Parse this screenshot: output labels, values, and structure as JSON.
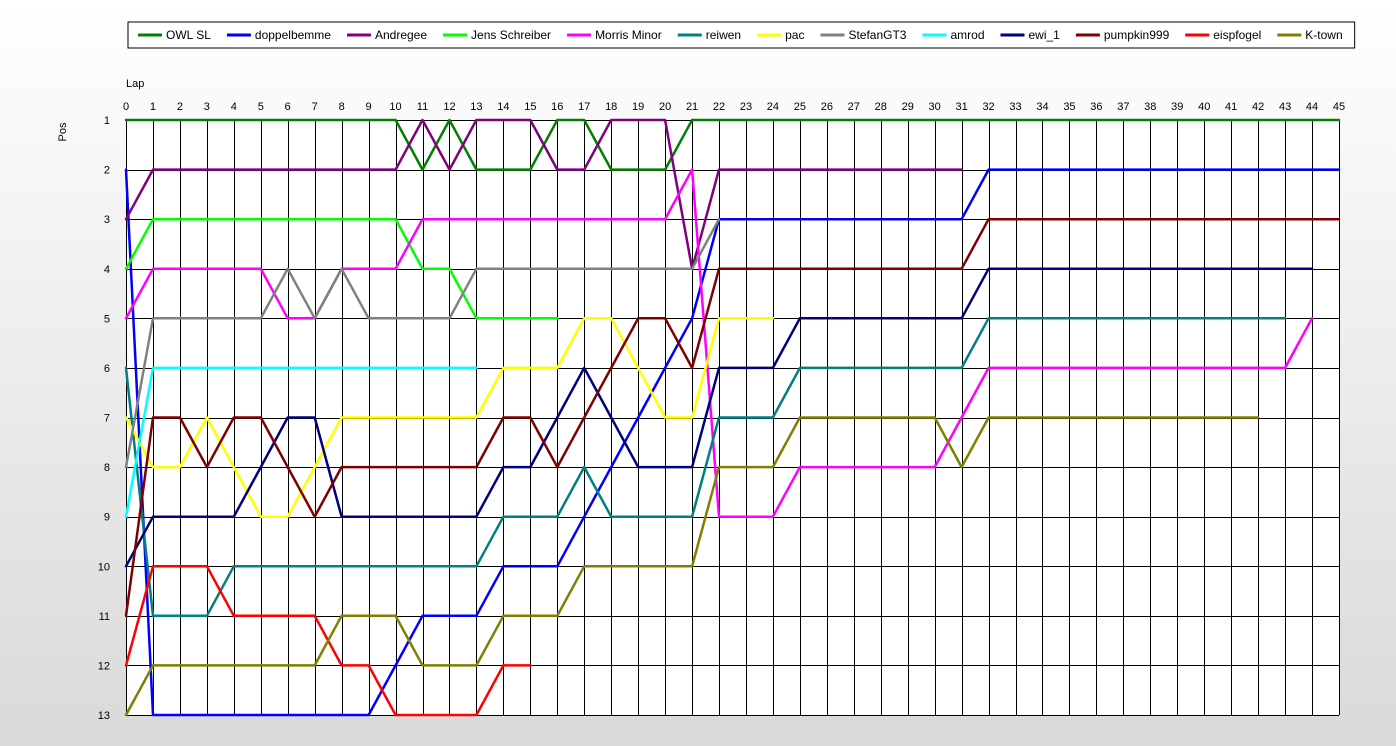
{
  "chart_data": {
    "type": "line",
    "xlabel": "Lap",
    "ylabel": "Pos",
    "xlim": [
      0,
      45
    ],
    "ylim": [
      1,
      13
    ],
    "y_inverted": true,
    "grid": true,
    "legend_position": "top",
    "x_ticks": [
      0,
      1,
      2,
      3,
      4,
      5,
      6,
      7,
      8,
      9,
      10,
      11,
      12,
      13,
      14,
      15,
      16,
      17,
      18,
      19,
      20,
      21,
      22,
      23,
      24,
      25,
      26,
      27,
      28,
      29,
      30,
      31,
      32,
      33,
      34,
      35,
      36,
      37,
      38,
      39,
      40,
      41,
      42,
      43,
      44,
      45
    ],
    "y_ticks": [
      1,
      2,
      3,
      4,
      5,
      6,
      7,
      8,
      9,
      10,
      11,
      12,
      13
    ],
    "series": [
      {
        "name": "OWL SL",
        "color": "#008000",
        "start_lap": 0,
        "positions": [
          1,
          1,
          1,
          1,
          1,
          1,
          1,
          1,
          1,
          1,
          1,
          2,
          1,
          2,
          2,
          2,
          1,
          1,
          2,
          2,
          2,
          1,
          1,
          1,
          1,
          1,
          1,
          1,
          1,
          1,
          1,
          1,
          1,
          1,
          1,
          1,
          1,
          1,
          1,
          1,
          1,
          1,
          1,
          1,
          1,
          1
        ]
      },
      {
        "name": "doppelbemme",
        "color": "#0000ff",
        "start_lap": 0,
        "positions": [
          2,
          13,
          13,
          13,
          13,
          13,
          13,
          13,
          13,
          13,
          12,
          11,
          11,
          11,
          10,
          10,
          10,
          9,
          8,
          7,
          6,
          5,
          3,
          3,
          3,
          3,
          3,
          3,
          3,
          3,
          3,
          3,
          2,
          2,
          2,
          2,
          2,
          2,
          2,
          2,
          2,
          2,
          2,
          2,
          2,
          2
        ]
      },
      {
        "name": "Andregee",
        "color": "#800080",
        "start_lap": 0,
        "positions": [
          3,
          2,
          2,
          2,
          2,
          2,
          2,
          2,
          2,
          2,
          2,
          1,
          2,
          1,
          1,
          1,
          2,
          2,
          1,
          1,
          1,
          4,
          2,
          2,
          2,
          2,
          2,
          2,
          2,
          2,
          2,
          2
        ]
      },
      {
        "name": "Jens Schreiber",
        "color": "#00ff00",
        "start_lap": 0,
        "positions": [
          4,
          3,
          3,
          3,
          3,
          3,
          3,
          3,
          3,
          3,
          3,
          4,
          4,
          5,
          5,
          5,
          5
        ]
      },
      {
        "name": "Morris Minor",
        "color": "#ff00ff",
        "start_lap": 0,
        "positions": [
          5,
          4,
          4,
          4,
          4,
          4,
          5,
          5,
          4,
          4,
          4,
          3,
          3,
          3,
          3,
          3,
          3,
          3,
          3,
          3,
          3,
          2,
          9,
          9,
          9,
          8,
          8,
          8,
          8,
          8,
          8,
          7,
          6,
          6,
          6,
          6,
          6,
          6,
          6,
          6,
          6,
          6,
          6,
          6,
          5
        ]
      },
      {
        "name": "reiwen",
        "color": "#008080",
        "start_lap": 0,
        "positions": [
          6,
          11,
          11,
          11,
          10,
          10,
          10,
          10,
          10,
          10,
          10,
          10,
          10,
          10,
          9,
          9,
          9,
          8,
          9,
          9,
          9,
          9,
          7,
          7,
          7,
          6,
          6,
          6,
          6,
          6,
          6,
          6,
          5,
          5,
          5,
          5,
          5,
          5,
          5,
          5,
          5,
          5,
          5,
          5
        ]
      },
      {
        "name": "pac",
        "color": "#ffff00",
        "start_lap": 0,
        "positions": [
          7,
          8,
          8,
          7,
          8,
          9,
          9,
          8,
          7,
          7,
          7,
          7,
          7,
          7,
          6,
          6,
          6,
          5,
          5,
          6,
          7,
          7,
          5,
          5,
          5
        ]
      },
      {
        "name": "StefanGT3",
        "color": "#808080",
        "start_lap": 0,
        "positions": [
          8,
          5,
          5,
          5,
          5,
          5,
          4,
          5,
          4,
          5,
          5,
          5,
          5,
          4,
          4,
          4,
          4,
          4,
          4,
          4,
          4,
          4,
          3
        ]
      },
      {
        "name": "amrod",
        "color": "#00ffff",
        "start_lap": 0,
        "positions": [
          9,
          6,
          6,
          6,
          6,
          6,
          6,
          6,
          6,
          6,
          6,
          6,
          6,
          6
        ]
      },
      {
        "name": "ewi_1",
        "color": "#000080",
        "start_lap": 0,
        "positions": [
          10,
          9,
          9,
          9,
          9,
          8,
          7,
          7,
          9,
          9,
          9,
          9,
          9,
          9,
          8,
          8,
          7,
          6,
          7,
          8,
          8,
          8,
          6,
          6,
          6,
          5,
          5,
          5,
          5,
          5,
          5,
          5,
          4,
          4,
          4,
          4,
          4,
          4,
          4,
          4,
          4,
          4,
          4,
          4,
          4
        ]
      },
      {
        "name": "pumpkin999",
        "color": "#800000",
        "start_lap": 0,
        "positions": [
          11,
          7,
          7,
          8,
          7,
          7,
          8,
          9,
          8,
          8,
          8,
          8,
          8,
          8,
          7,
          7,
          8,
          7,
          6,
          5,
          5,
          6,
          4,
          4,
          4,
          4,
          4,
          4,
          4,
          4,
          4,
          4,
          3,
          3,
          3,
          3,
          3,
          3,
          3,
          3,
          3,
          3,
          3,
          3,
          3,
          3
        ]
      },
      {
        "name": "eispfogel",
        "color": "#ff0000",
        "start_lap": 0,
        "positions": [
          12,
          10,
          10,
          10,
          11,
          11,
          11,
          11,
          12,
          12,
          13,
          13,
          13,
          13,
          12,
          12
        ]
      },
      {
        "name": "K-town",
        "color": "#808000",
        "start_lap": 0,
        "positions": [
          13,
          12,
          12,
          12,
          12,
          12,
          12,
          12,
          11,
          11,
          11,
          12,
          12,
          12,
          11,
          11,
          11,
          10,
          10,
          10,
          10,
          10,
          8,
          8,
          8,
          7,
          7,
          7,
          7,
          7,
          7,
          8,
          7,
          7,
          7,
          7,
          7,
          7,
          7,
          7,
          7,
          7,
          7
        ]
      }
    ]
  }
}
